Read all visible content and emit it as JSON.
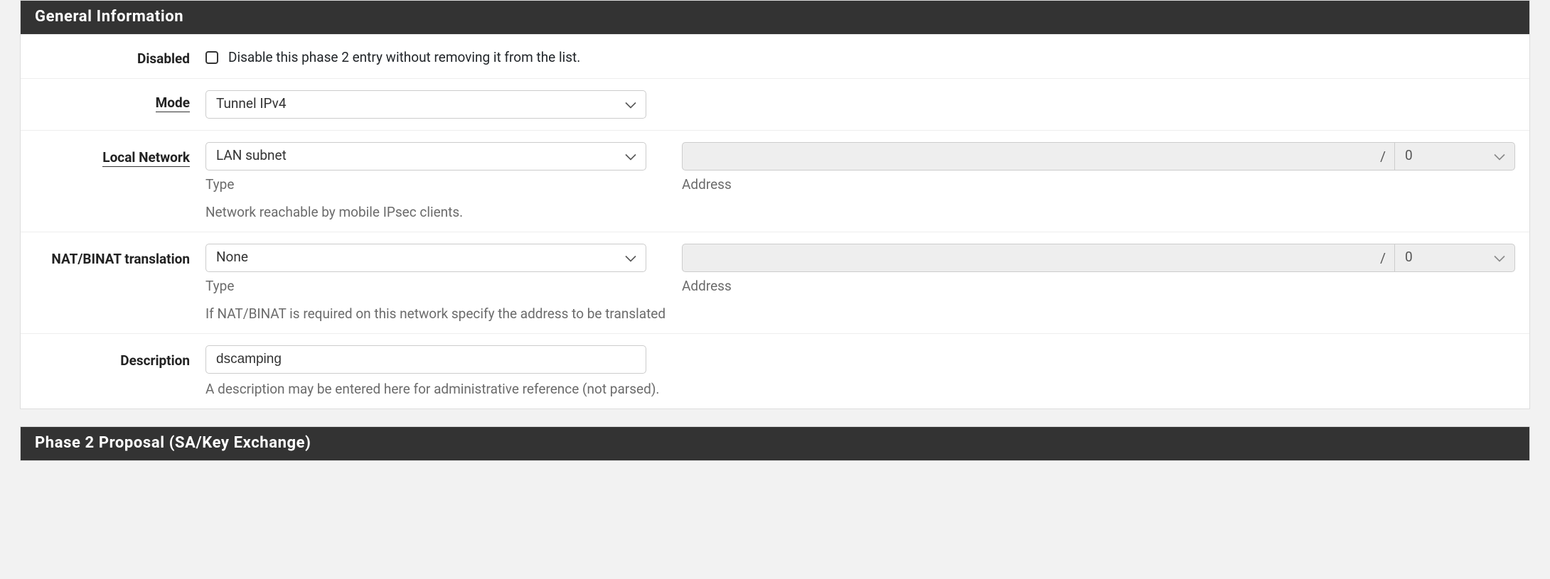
{
  "panels": {
    "general": {
      "title": "General Information"
    },
    "phase2": {
      "title": "Phase 2 Proposal (SA/Key Exchange)"
    }
  },
  "general": {
    "disabled": {
      "label": "Disabled",
      "checkbox_text": "Disable this phase 2 entry without removing it from the list.",
      "checked": false
    },
    "mode": {
      "label": "Mode",
      "value": "Tunnel IPv4"
    },
    "local_network": {
      "label": "Local Network",
      "type_value": "LAN subnet",
      "type_caption": "Type",
      "addr_value": "",
      "addr_caption": "Address",
      "mask_value": "0",
      "slash": "/",
      "help": "Network reachable by mobile IPsec clients."
    },
    "natbinat": {
      "label": "NAT/BINAT translation",
      "type_value": "None",
      "type_caption": "Type",
      "addr_value": "",
      "addr_caption": "Address",
      "mask_value": "0",
      "slash": "/",
      "help": "If NAT/BINAT is required on this network specify the address to be translated"
    },
    "description": {
      "label": "Description",
      "value": "dscamping",
      "help": "A description may be entered here for administrative reference (not parsed)."
    }
  }
}
